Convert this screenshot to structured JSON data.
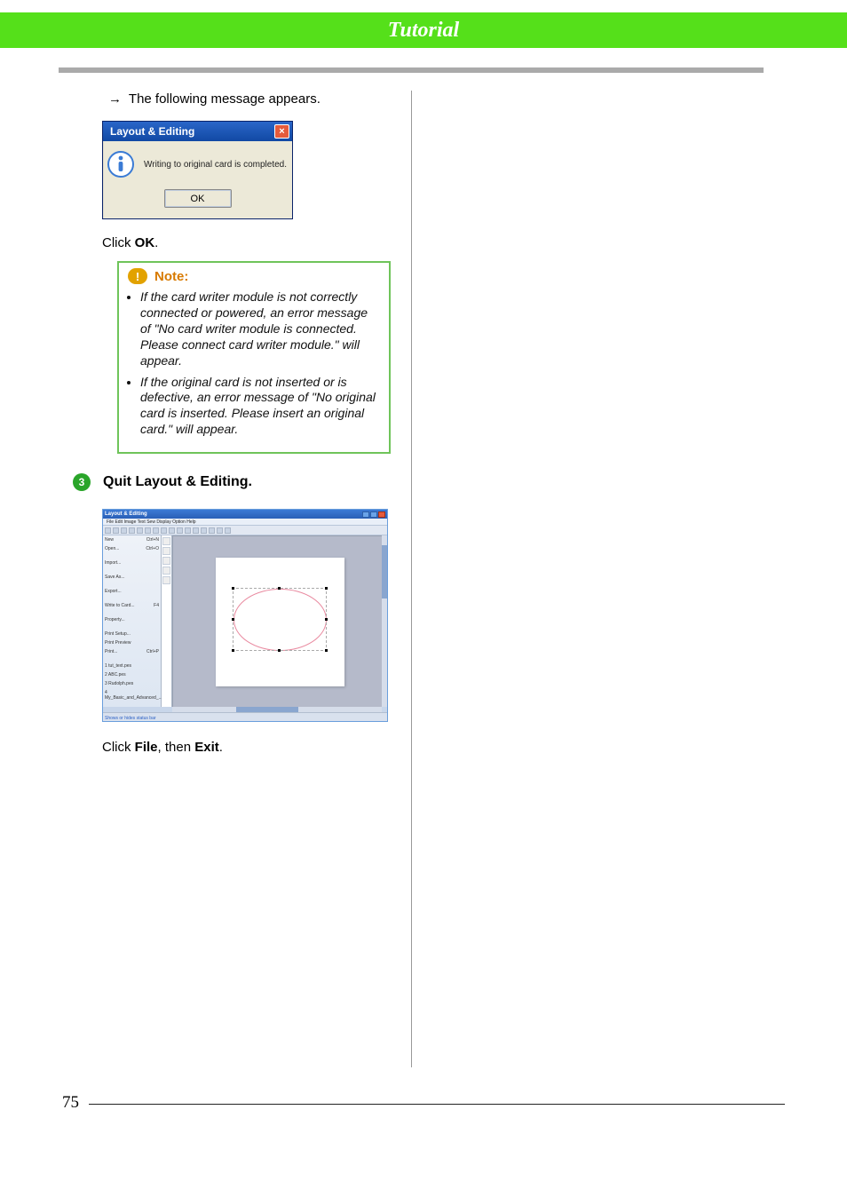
{
  "page": {
    "header_title": "Tutorial",
    "page_number": "75"
  },
  "line1_pre_arrow": "→",
  "line1_text": "The following message appears.",
  "dialog": {
    "title": "Layout & Editing",
    "message": "Writing to original card is completed.",
    "ok_label": "OK"
  },
  "click_ok_pre": "Click ",
  "click_ok_bold": "OK",
  "click_ok_post": ".",
  "note": {
    "label": "Note:",
    "bullets": [
      "If the card writer module is not correctly connected or powered, an error message of \"No card writer module is connected. Please connect card writer module.\" will appear.",
      "If the original card is not inserted or is defective, an error message of \"No original card is inserted. Please insert an original card.\" will appear."
    ]
  },
  "step3": {
    "num": "3",
    "title": "Quit Layout & Editing."
  },
  "screenshot": {
    "window_title": "Layout & Editing",
    "menu": "File  Edit  Image  Text  Sew  Display  Option  Help",
    "status_tip": "Shows or hides status bar"
  },
  "click_file_pre": "Click ",
  "click_file_b1": "File",
  "click_file_mid": ", then ",
  "click_file_b2": "Exit",
  "click_file_post": "."
}
